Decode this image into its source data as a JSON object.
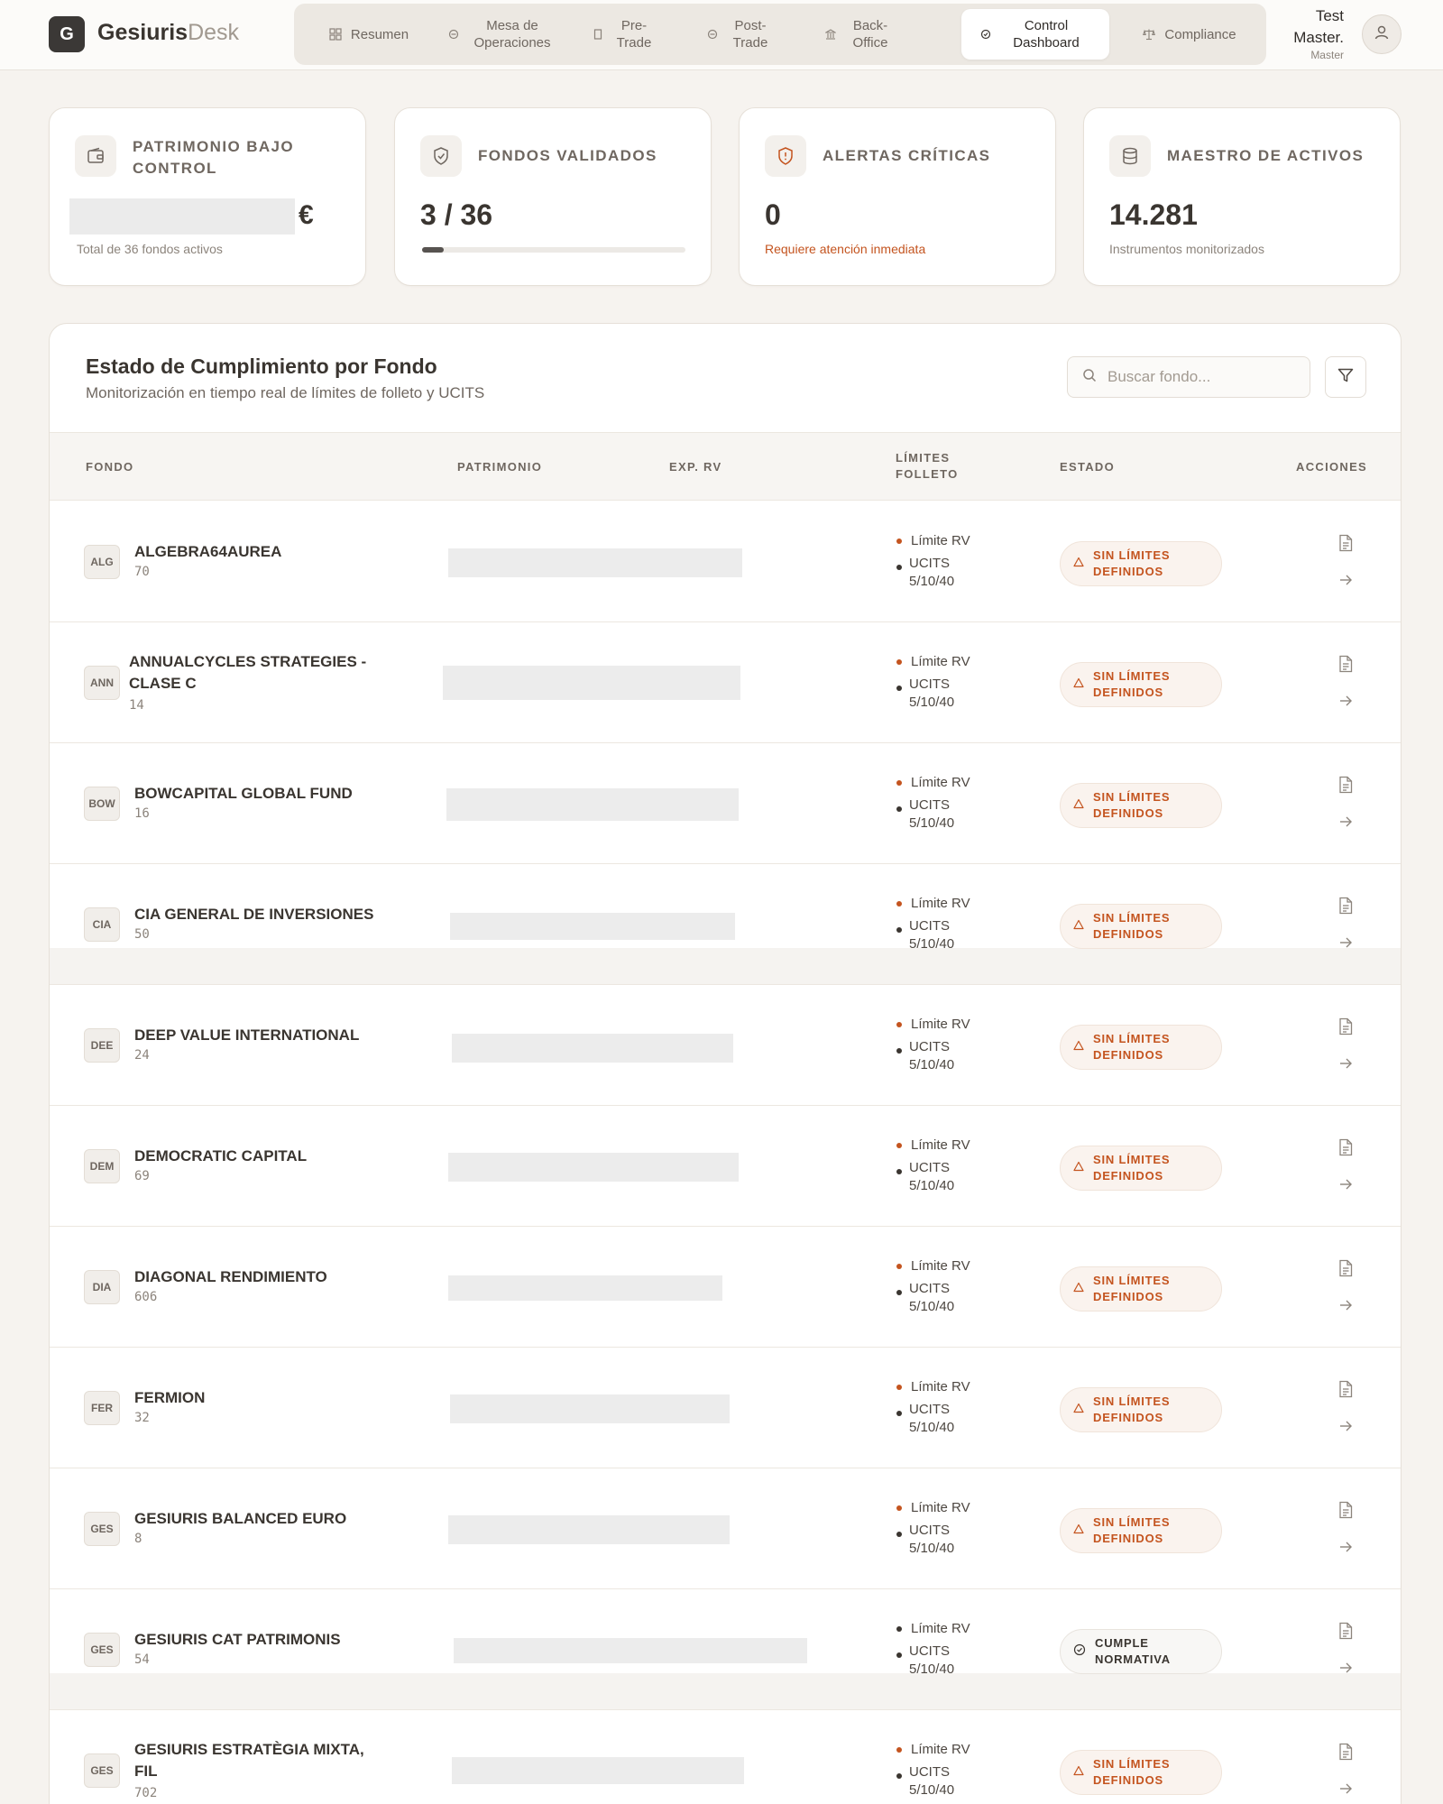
{
  "app": {
    "logo_letter": "G",
    "name_bold": "Gesiuris",
    "name_light": "Desk"
  },
  "nav": [
    {
      "label": "Resumen",
      "icon": "grid-icon",
      "active": false
    },
    {
      "label": "Mesa de Operaciones",
      "icon": "circle-icon",
      "active": false
    },
    {
      "label": "Pre-Trade",
      "icon": "doc-icon",
      "active": false
    },
    {
      "label": "Post-Trade",
      "icon": "circle-icon",
      "active": false
    },
    {
      "label": "Back-Office",
      "icon": "bank-icon",
      "active": false
    },
    {
      "label": "Control Dashboard",
      "icon": "check-circle-icon",
      "active": true
    },
    {
      "label": "Compliance",
      "icon": "scale-icon",
      "active": false
    }
  ],
  "user": {
    "name": "Test Master.",
    "role": "Master"
  },
  "kpis": {
    "patrimonio": {
      "title": "PATRIMONIO BAJO CONTROL",
      "currency": "€",
      "sub": "Total de 36 fondos activos"
    },
    "fondos": {
      "title": "FONDOS VALIDADOS",
      "value": "3 / 36",
      "progress": 0.083
    },
    "alertas": {
      "title": "ALERTAS CRÍTICAS",
      "value": "0",
      "sub": "Requiere atención inmediata"
    },
    "maestro": {
      "title": "MAESTRO DE ACTIVOS",
      "value": "14.281",
      "sub": "Instrumentos monitorizados"
    }
  },
  "panel": {
    "title": "Estado de Cumplimiento por Fondo",
    "subtitle": "Monitorización en tiempo real de límites de folleto y UCITS",
    "search_placeholder": "Buscar fondo..."
  },
  "columns": {
    "fondo": "FONDO",
    "patrimonio": "PATRIMONIO",
    "exp_rv": "EXP. RV",
    "limites_1": "LÍMITES",
    "limites_2": "FOLLETO",
    "estado": "ESTADO",
    "acciones": "ACCIONES"
  },
  "limits_text": {
    "l1": "Límite RV",
    "l2": "UCITS",
    "l3": "5/10/40"
  },
  "rows": [
    {
      "code": "ALG",
      "name": [
        "ALGEBRA64AUREA"
      ],
      "id": "70",
      "status": "SIN LÍMITES DEFINIDOS",
      "ok": false
    },
    {
      "code": "ANN",
      "name": [
        "ANNUALCYCLES STRATEGIES -",
        "CLASE C"
      ],
      "id": "14",
      "status": "SIN LÍMITES DEFINIDOS",
      "ok": false
    },
    {
      "code": "BOW",
      "name": [
        "BOWCAPITAL GLOBAL FUND"
      ],
      "id": "16",
      "status": "SIN LÍMITES DEFINIDOS",
      "ok": false
    },
    {
      "code": "CIA",
      "name": [
        "CIA GENERAL DE INVERSIONES"
      ],
      "id": "50",
      "status": "SIN LÍMITES DEFINIDOS",
      "ok": false
    },
    {
      "code": "DEE",
      "name": [
        "DEEP VALUE INTERNATIONAL"
      ],
      "id": "24",
      "status": "SIN LÍMITES DEFINIDOS",
      "ok": false
    },
    {
      "code": "DEM",
      "name": [
        "DEMOCRATIC CAPITAL"
      ],
      "id": "69",
      "status": "SIN LÍMITES DEFINIDOS",
      "ok": false
    },
    {
      "code": "DIA",
      "name": [
        "DIAGONAL RENDIMIENTO"
      ],
      "id": "606",
      "status": "SIN LÍMITES DEFINIDOS",
      "ok": false
    },
    {
      "code": "FER",
      "name": [
        "FERMION"
      ],
      "id": "32",
      "status": "SIN LÍMITES DEFINIDOS",
      "ok": false
    },
    {
      "code": "GES",
      "name": [
        "GESIURIS BALANCED EURO"
      ],
      "id": "8",
      "status": "SIN LÍMITES DEFINIDOS",
      "ok": false
    },
    {
      "code": "GES",
      "name": [
        "GESIURIS CAT PATRIMONIS"
      ],
      "id": "54",
      "status": "CUMPLE NORMATIVA",
      "ok": true
    },
    {
      "code": "GES",
      "name": [
        "GESIURIS ESTRATÈGIA MIXTA,",
        "FIL"
      ],
      "id": "702",
      "status": "SIN LÍMITES DEFINIDOS",
      "ok": false
    }
  ],
  "colors": {
    "accent": "#c4541f",
    "background": "#f6f3ef",
    "dark": "#3b3836"
  }
}
